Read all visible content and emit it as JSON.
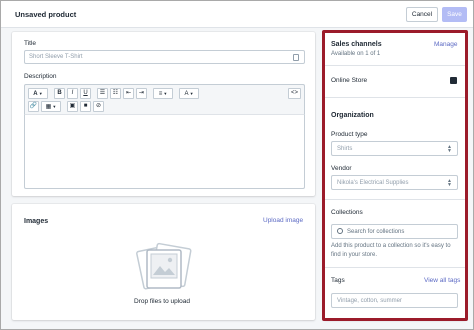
{
  "header": {
    "title": "Unsaved product",
    "cancel_label": "Cancel",
    "save_label": "Save"
  },
  "main": {
    "title_label": "Title",
    "title_placeholder": "Short Sleeve T-Shirt",
    "description_label": "Description",
    "toolbar": {
      "paragraph": "A",
      "bold": "B",
      "italic": "I",
      "underline": "U",
      "html": "<>"
    },
    "images": {
      "title": "Images",
      "upload_link": "Upload image",
      "drop_text": "Drop files to upload"
    }
  },
  "sidebar": {
    "sales_channels": {
      "title": "Sales channels",
      "manage_link": "Manage",
      "availability": "Available on 1 of 1",
      "channel": "Online Store"
    },
    "organization": {
      "title": "Organization",
      "product_type_label": "Product type",
      "product_type_value": "Shirts",
      "vendor_label": "Vendor",
      "vendor_value": "Nikola's Electrical Supplies",
      "collections_label": "Collections",
      "collections_placeholder": "Search for collections",
      "collections_help": "Add this product to a collection so it's easy to find in your store.",
      "tags_label": "Tags",
      "tags_link": "View all tags",
      "tags_placeholder": "Vintage, cotton, summer"
    }
  },
  "colors": {
    "accent": "#5c6ac4",
    "save_disabled": "#b3bcf5",
    "highlight_border": "#9b1b2a"
  }
}
